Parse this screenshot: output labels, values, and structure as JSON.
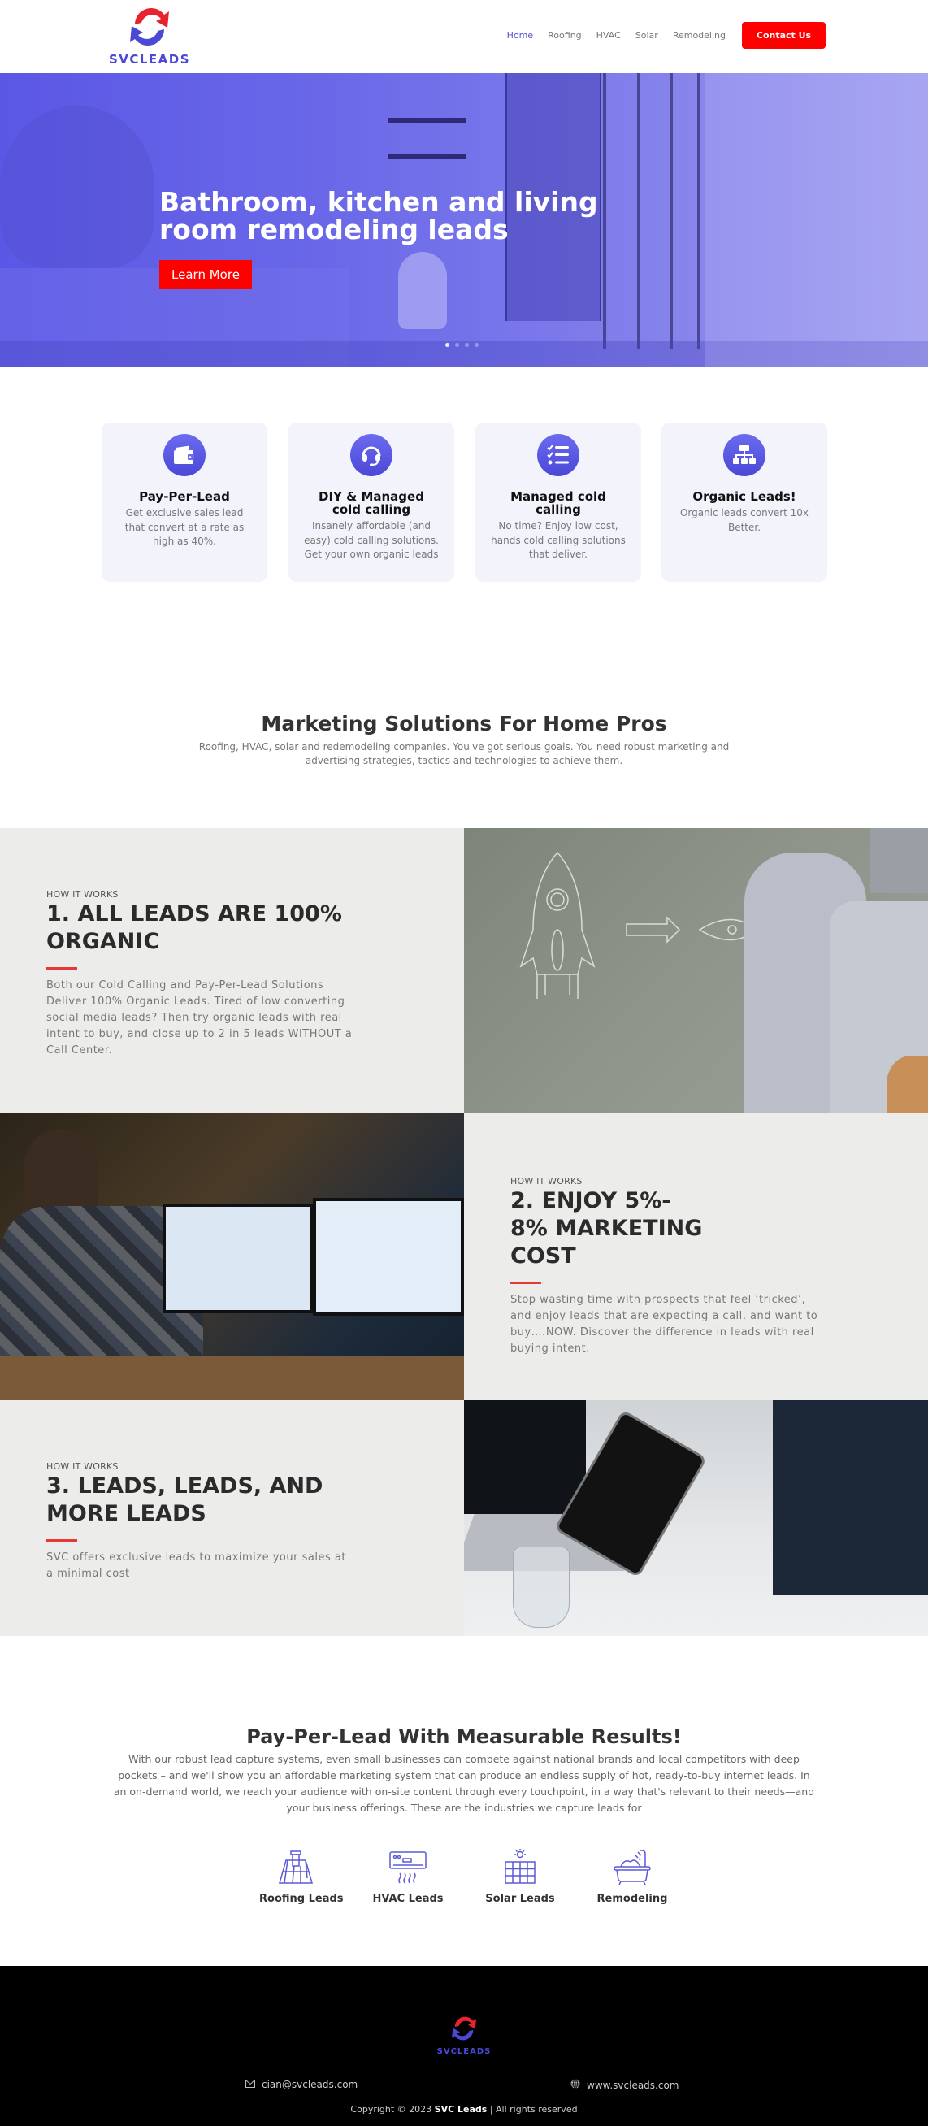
{
  "brand": {
    "name": "SVCLEADS",
    "colors": {
      "primary": "#4b48d6",
      "accent": "#ff0000",
      "logo_red": "#e8232f"
    }
  },
  "header": {
    "nav": [
      {
        "label": "Home",
        "active": true
      },
      {
        "label": "Roofing",
        "active": false
      },
      {
        "label": "HVAC",
        "active": false
      },
      {
        "label": "Solar",
        "active": false
      },
      {
        "label": "Remodeling",
        "active": false
      }
    ],
    "contact_label": "Contact Us"
  },
  "hero": {
    "title": "Bathroom, kitchen and living room remodeling leads",
    "cta_label": "Learn More",
    "slides": 4,
    "active_slide": 1
  },
  "features": [
    {
      "icon": "wallet-icon",
      "title": "Pay-Per-Lead",
      "desc": "Get exclusive sales lead that convert at a rate as high as 40%."
    },
    {
      "icon": "headset-icon",
      "title": "DIY & Managed cold calling",
      "desc": "Insanely affordable (and easy) cold calling solutions. Get your own organic leads"
    },
    {
      "icon": "checklist-icon",
      "title": "Managed cold calling",
      "desc": "No time? Enjoy low cost, hands cold calling solutions that deliver."
    },
    {
      "icon": "sitemap-icon",
      "title": "Organic Leads!",
      "desc": "Organic leads convert 10x Better."
    }
  ],
  "marketing": {
    "title": "Marketing Solutions For Home Pros",
    "desc": "Roofing, HVAC, solar and redemodeling companies. You've got serious goals. You need robust marketing and advertising strategies, tactics and technologies to achieve them."
  },
  "how_it_works": [
    {
      "kicker": "HOW IT WORKS",
      "title": "1. ALL LEADS ARE 100% ORGANIC",
      "desc": "Both our Cold Calling and Pay-Per-Lead Solutions Deliver 100% Organic Leads. Tired of low converting social media leads? Then try organic leads with real intent to buy, and close up to 2 in 5 leads WITHOUT a Call Center.",
      "image": "rocket-sketch-laptop-photo"
    },
    {
      "kicker": "HOW IT WORKS",
      "title": "2. ENJOY 5%- 8% MARKETING COST",
      "desc": "Stop wasting time with prospects that feel ‘tricked’, and enjoy leads that are expecting a call, and want to buy….NOW. Discover the difference in leads with real buying intent.",
      "image": "analyst-dual-monitor-photo"
    },
    {
      "kicker": "HOW IT WORKS",
      "title": "3. LEADS, LEADS, AND MORE LEADS",
      "desc": "SVC offers exclusive leads to maximize your sales at a minimal cost",
      "image": "trading-tablet-photo"
    }
  ],
  "ppl": {
    "title": "Pay-Per-Lead With Measurable Results!",
    "desc": "With our robust lead capture systems, even small businesses can compete against national brands and local competitors with deep pockets – and we'll show you an affordable marketing system that can produce an endless supply of hot, ready-to-buy internet leads. In an on-demand world, we reach your audience with on-site content through every touchpoint, in a way that's relevant to their needs—and your business offerings. These are the industries we capture leads for",
    "industries": [
      {
        "icon": "roof-icon",
        "label": "Roofing Leads"
      },
      {
        "icon": "air-conditioner-icon",
        "label": "HVAC Leads"
      },
      {
        "icon": "solar-panel-icon",
        "label": "Solar Leads"
      },
      {
        "icon": "bathtub-icon",
        "label": "Remodeling"
      }
    ]
  },
  "footer": {
    "email": "cian@svcleads.com",
    "website": "www.svcleads.com",
    "copyright_prefix": "Copyright © 2023",
    "copyright_brand": "SVC Leads",
    "copyright_suffix": "| All rights reserved"
  }
}
